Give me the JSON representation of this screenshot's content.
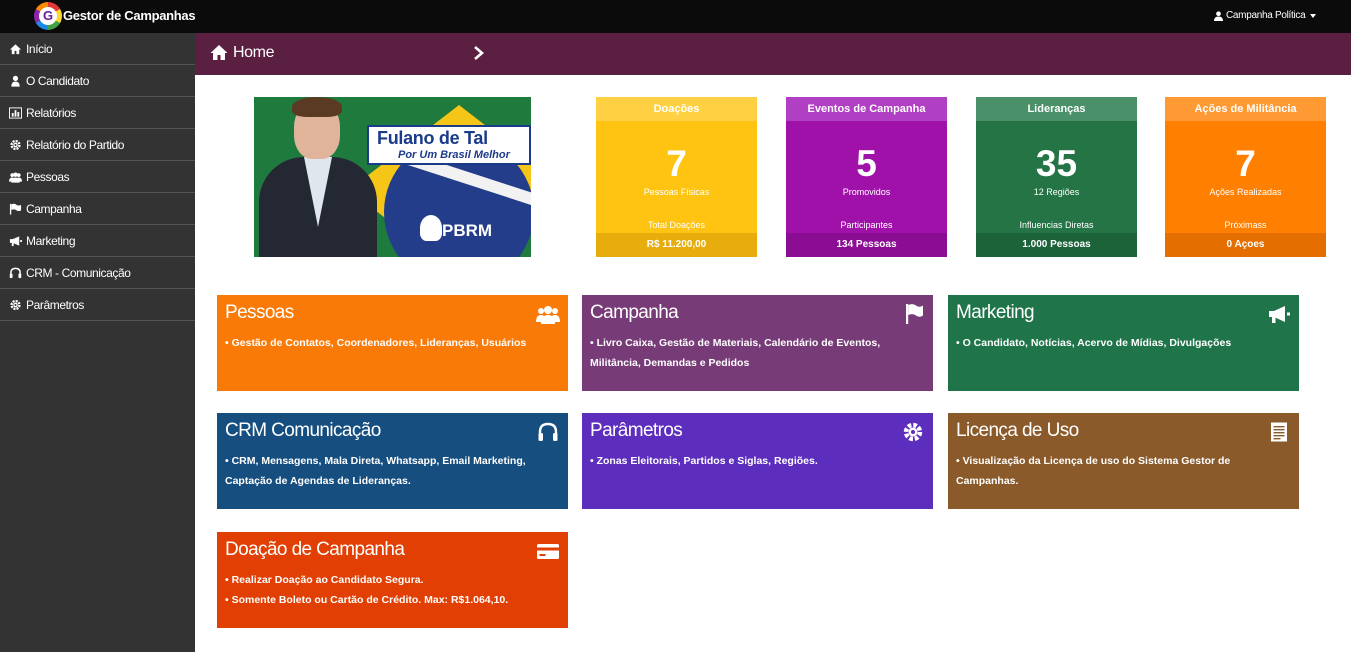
{
  "app": {
    "title": "Gestor de Campanhas",
    "logo_letter": "G"
  },
  "user_menu": {
    "label": "Campanha Política"
  },
  "sidebar": {
    "items": [
      {
        "label": "Início",
        "icon": "home-icon"
      },
      {
        "label": "O Candidato",
        "icon": "user-icon"
      },
      {
        "label": "Relatórios",
        "icon": "bar-chart-icon"
      },
      {
        "label": "Relatório do Partido",
        "icon": "gear-icon"
      },
      {
        "label": "Pessoas",
        "icon": "users-icon"
      },
      {
        "label": "Campanha",
        "icon": "flag-icon"
      },
      {
        "label": "Marketing",
        "icon": "megaphone-icon"
      },
      {
        "label": "CRM - Comunicação",
        "icon": "headphones-icon"
      },
      {
        "label": "Parâmetros",
        "icon": "gear-icon"
      }
    ]
  },
  "breadcrumb": {
    "label": "Home"
  },
  "banner": {
    "name": "Fulano de Tal",
    "slogan": "Por Um Brasil Melhor",
    "party": "PBRM"
  },
  "stats": [
    {
      "title": "Doações",
      "value": "7",
      "subtitle": "Pessoas Físicas",
      "footer_label": "Total Doações",
      "footer_value": "R$ 11.200,00",
      "colors": {
        "head": "#ffd042",
        "body": "#ffc312",
        "foot": "#e6ad0d"
      }
    },
    {
      "title": "Eventos de Campanha",
      "value": "5",
      "subtitle": "Promovidos",
      "footer_label": "Participantes",
      "footer_value": "134 Pessoas",
      "colors": {
        "head": "#b13fc4",
        "body": "#a011aa",
        "foot": "#8a0d93"
      }
    },
    {
      "title": "Lideranças",
      "value": "35",
      "subtitle": "12 Regiões",
      "footer_label": "Influencias Diretas",
      "footer_value": "1.000 Pessoas",
      "colors": {
        "head": "#4a9069",
        "body": "#247446",
        "foot": "#1d633a"
      }
    },
    {
      "title": "Ações de Militância",
      "value": "7",
      "subtitle": "Ações Realizadas",
      "footer_label": "Próximass",
      "footer_value": "0 Açoes",
      "colors": {
        "head": "#ff9933",
        "body": "#ff7f00",
        "foot": "#e56e00"
      }
    }
  ],
  "tiles": [
    {
      "title": "Pessoas",
      "icon": "users-icon",
      "color": "#fa7a08",
      "lines": [
        "• Gestão de Contatos, Coordenadores, Lideranças, Usuários"
      ]
    },
    {
      "title": "Campanha",
      "icon": "flag-icon",
      "color": "#773b77",
      "lines": [
        "• Livro Caixa, Gestão de Materiais, Calendário de Eventos,",
        "Militância, Demandas e Pedidos"
      ]
    },
    {
      "title": "Marketing",
      "icon": "megaphone-icon",
      "color": "#1f7549",
      "lines": [
        "• O Candidato, Notícias, Acervo de Mídias, Divulgações"
      ]
    },
    {
      "title": "CRM Comunicação",
      "icon": "headphones-icon",
      "color": "#164e7f",
      "lines": [
        "• CRM, Mensagens, Mala Direta, Whatsapp, Email Marketing,",
        "Captação de Agendas de Lideranças."
      ]
    },
    {
      "title": "Parâmetros",
      "icon": "gear-icon",
      "color": "#5d2dbd",
      "lines": [
        "• Zonas Eleitorais, Partidos e Siglas, Regiões."
      ]
    },
    {
      "title": "Licença de Uso",
      "icon": "document-icon",
      "color": "#8b5a2b",
      "lines": [
        "• Visualização da Licença de uso do Sistema Gestor de",
        "Campanhas."
      ]
    },
    {
      "title": "Doação de Campanha",
      "icon": "credit-card-icon",
      "color": "#e23f04",
      "lines": [
        "• Realizar Doação ao Candidato Segura.",
        "• Somente Boleto ou Cartão de Crédito. Max: R$1.064,10."
      ]
    }
  ]
}
